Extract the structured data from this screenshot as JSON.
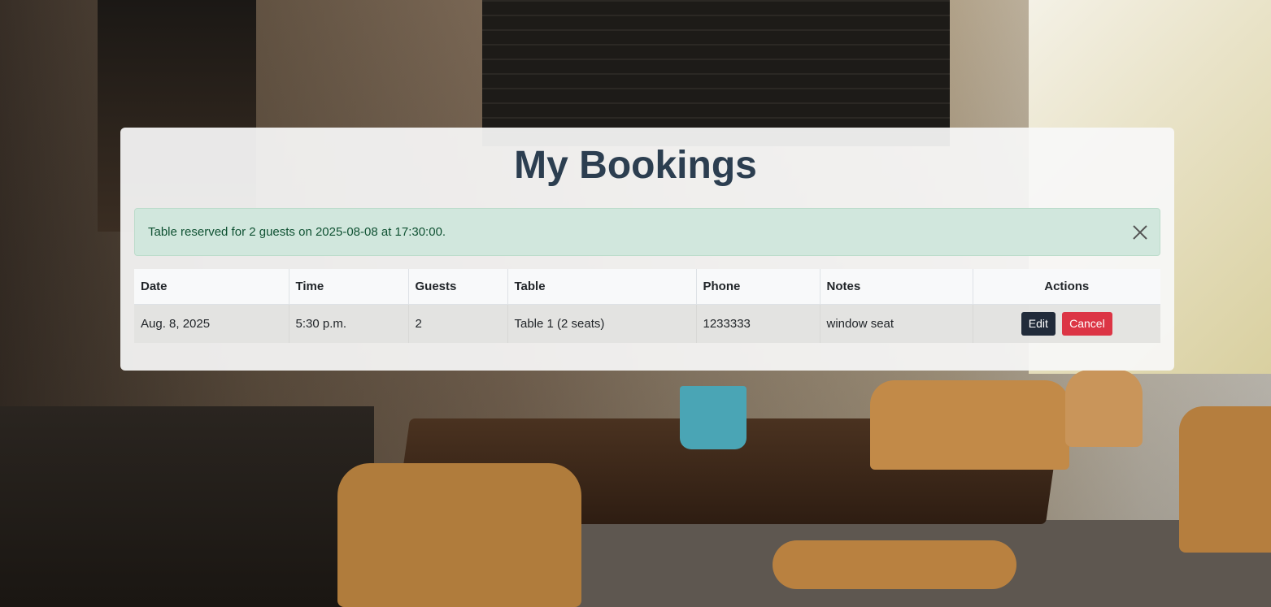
{
  "page": {
    "title": "My Bookings"
  },
  "alert": {
    "message": "Table reserved for 2 guests on 2025-08-08 at 17:30:00.",
    "close_icon": "close-icon"
  },
  "table": {
    "headers": {
      "date": "Date",
      "time": "Time",
      "guests": "Guests",
      "table": "Table",
      "phone": "Phone",
      "notes": "Notes",
      "actions": "Actions"
    },
    "rows": [
      {
        "date": "Aug. 8, 2025",
        "time": "5:30 p.m.",
        "guests": "2",
        "table": "Table 1 (2 seats)",
        "phone": "1233333",
        "notes": "window seat",
        "edit_label": "Edit",
        "cancel_label": "Cancel"
      }
    ]
  },
  "colors": {
    "title": "#2c3e50",
    "alert_bg": "#d1e7dd",
    "alert_text": "#0f5132",
    "edit_button": "#212b3a",
    "cancel_button": "#dc3545"
  }
}
